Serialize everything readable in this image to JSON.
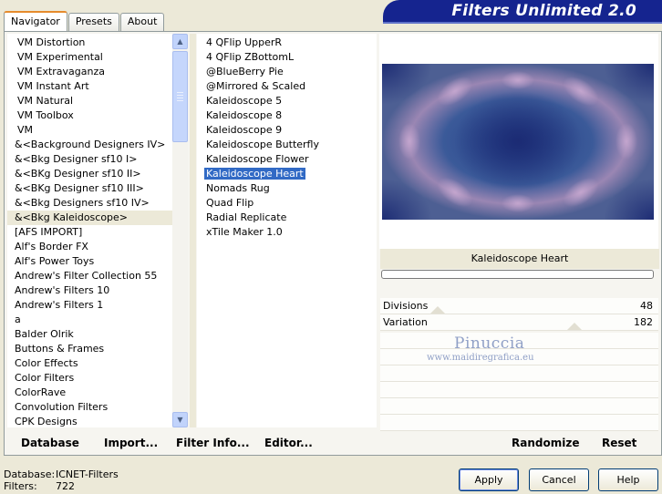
{
  "tabs": [
    "Navigator",
    "Presets",
    "About"
  ],
  "banner_title": "Filters Unlimited 2.0",
  "categories": [
    {
      "label": "VM Distortion",
      "indent": true
    },
    {
      "label": "VM Experimental",
      "indent": true
    },
    {
      "label": "VM Extravaganza",
      "indent": true
    },
    {
      "label": "VM Instant Art",
      "indent": true
    },
    {
      "label": "VM Natural",
      "indent": true
    },
    {
      "label": "VM Toolbox",
      "indent": true
    },
    {
      "label": "VM",
      "indent": true
    },
    {
      "label": "&<Background Designers IV>"
    },
    {
      "label": "&<Bkg Designer sf10 I>"
    },
    {
      "label": "&<BKg Designer sf10 II>"
    },
    {
      "label": "&<BKg Designer sf10 III>"
    },
    {
      "label": "&<Bkg Designers sf10 IV>"
    },
    {
      "label": "&<Bkg Kaleidoscope>",
      "selected": true
    },
    {
      "label": "[AFS IMPORT]"
    },
    {
      "label": "Alf's Border FX"
    },
    {
      "label": "Alf's Power Toys"
    },
    {
      "label": "Andrew's Filter Collection 55"
    },
    {
      "label": "Andrew's Filters 10"
    },
    {
      "label": "Andrew's Filters 1"
    },
    {
      "label": "a"
    },
    {
      "label": "Balder Olrik"
    },
    {
      "label": "Buttons & Frames"
    },
    {
      "label": "Color Effects"
    },
    {
      "label": "Color Filters"
    },
    {
      "label": "ColorRave"
    },
    {
      "label": "Convolution Filters"
    },
    {
      "label": "CPK Designs"
    }
  ],
  "filters": [
    {
      "label": "4 QFlip UpperR"
    },
    {
      "label": "4 QFlip ZBottomL"
    },
    {
      "label": "@BlueBerry Pie"
    },
    {
      "label": "@Mirrored & Scaled"
    },
    {
      "label": "Kaleidoscope 5"
    },
    {
      "label": "Kaleidoscope 8"
    },
    {
      "label": "Kaleidoscope 9"
    },
    {
      "label": "Kaleidoscope Butterfly"
    },
    {
      "label": "Kaleidoscope Flower"
    },
    {
      "label": "Kaleidoscope Heart",
      "selected": true
    },
    {
      "label": "Nomads Rug"
    },
    {
      "label": "Quad Flip"
    },
    {
      "label": "Radial Replicate"
    },
    {
      "label": "xTile Maker 1.0"
    }
  ],
  "selected_filter": "Kaleidoscope Heart",
  "progress": 0,
  "controls": [
    {
      "label": "Divisions",
      "value": "48",
      "level": 0.19
    },
    {
      "label": "Variation",
      "value": "182",
      "level": 0.71
    }
  ],
  "watermark": {
    "name": "Pinuccia",
    "url": "www.maidiregrafica.eu"
  },
  "bottom_links": {
    "database": "Database",
    "import": "Import...",
    "filter_info": "Filter Info...",
    "editor": "Editor...",
    "randomize": "Randomize",
    "reset": "Reset"
  },
  "status": {
    "database_label": "Database:",
    "database_value": "ICNET-Filters",
    "filters_label": "Filters:",
    "filters_value": "722"
  },
  "buttons": {
    "apply": "Apply",
    "cancel": "Cancel",
    "help": "Help"
  },
  "colors": {
    "selection": "#316ac5",
    "banner": "#15248f",
    "tab_accent": "#e68b2c"
  },
  "icons": {
    "scroll_up": "scroll-up-arrow-icon",
    "scroll_down": "scroll-down-arrow-icon"
  }
}
